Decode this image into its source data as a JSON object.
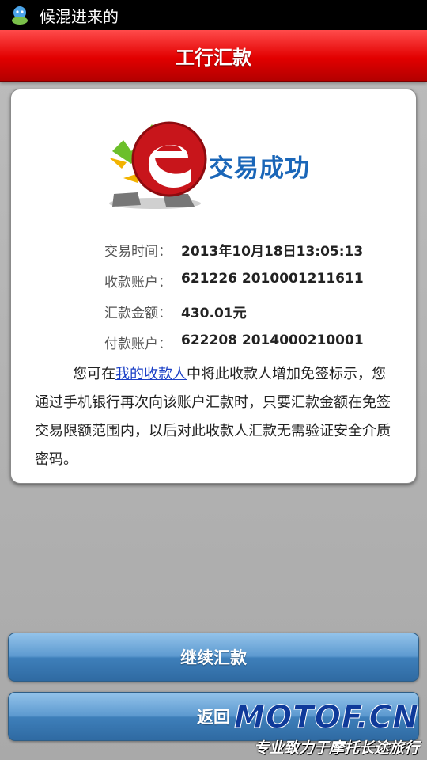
{
  "status_bar": {
    "title": "候混进来的",
    "icon": "app-notification-icon"
  },
  "header": {
    "title": "工行汇款"
  },
  "result": {
    "status_text": "交易成功",
    "logo_icon": "success-check-e-mascot-icon",
    "details": [
      {
        "label": "交易时间：",
        "value": "2013年10月18日13:05:13"
      },
      {
        "label": "收款账户：",
        "value": "621226 2010001211611"
      },
      {
        "label": "汇款金额：",
        "value": "430.01元"
      },
      {
        "label": "付款账户：",
        "value": "622208 2014000210001"
      }
    ],
    "notice": {
      "prefix": "您可在",
      "link_text": "我的收款人",
      "suffix": "中将此收款人增加免签标示，您通过手机银行再次向该账户汇款时，只要汇款金额在免签交易限额范围内，以后对此收款人汇款无需验证安全介质密码。"
    }
  },
  "actions": {
    "continue_label": "继续汇款",
    "back_label": "返回"
  },
  "watermark": {
    "logo": "MOTOF.CN",
    "tagline": "专业致力于摩托长途旅行"
  },
  "colors": {
    "header_red": "#e20000",
    "button_blue": "#3e7fba",
    "success_blue": "#1a66b8"
  }
}
